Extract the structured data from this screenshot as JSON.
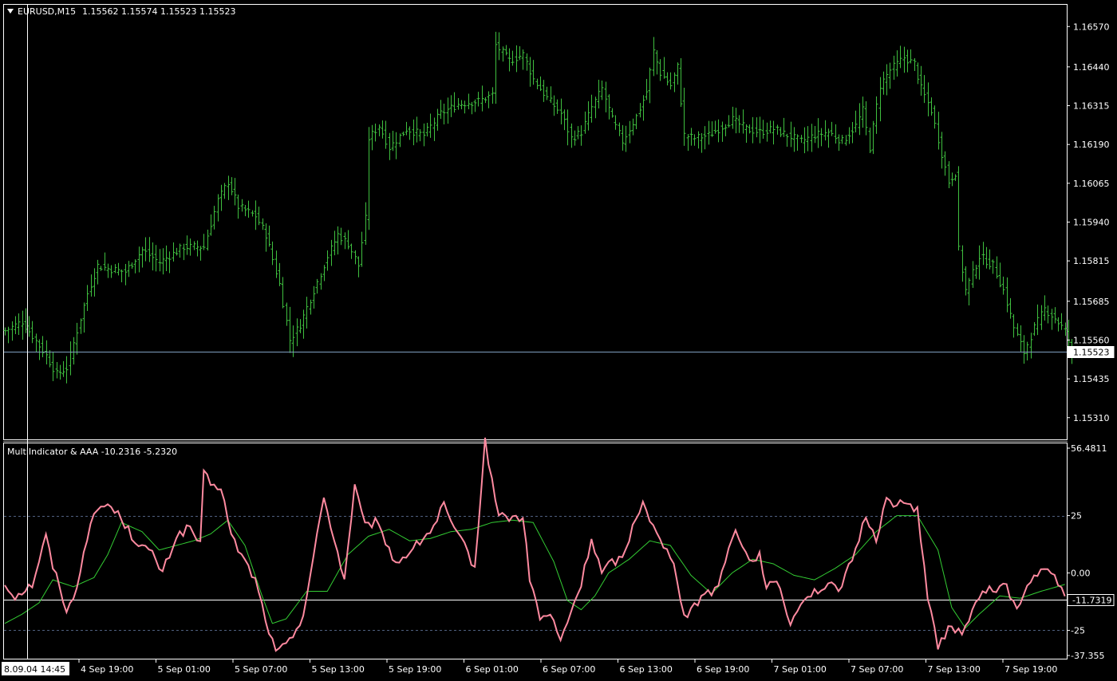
{
  "main_panel": {
    "symbol_timeframe": "EURUSD,M15",
    "ohlc": "1.15562 1.15574 1.15523 1.15523",
    "menu_icon": "triangle-down-icon",
    "current_price_label": "1.15523",
    "price_ticks": [
      "1.16570",
      "1.16440",
      "1.16315",
      "1.16190",
      "1.16065",
      "1.15940",
      "1.15815",
      "1.15685",
      "1.15560",
      "1.15435",
      "1.15310"
    ]
  },
  "indicator_panel": {
    "title": "MultiIndicator & AAA -10.2316 -5.2320",
    "ticks": [
      "56.4811",
      "25",
      "0.00",
      "-11.7319",
      "-25",
      "-37.355"
    ]
  },
  "time_axis": {
    "cursor_label": "8.09.04 14:45",
    "labels": [
      "4 Sep 19:00",
      "5 Sep 01:00",
      "5 Sep 07:00",
      "5 Sep 13:00",
      "5 Sep 19:00",
      "6 Sep 01:00",
      "6 Sep 07:00",
      "6 Sep 13:00",
      "6 Sep 19:00",
      "7 Sep 01:00",
      "7 Sep 07:00",
      "7 Sep 13:00",
      "7 Sep 19:00"
    ]
  },
  "colors": {
    "background": "#000000",
    "bars": "#3fbf3f",
    "fast_line": "#ff8aa0",
    "slow_line": "#33cc33",
    "grid_level": "#506080",
    "text": "#ffffff"
  },
  "chart_data": [
    {
      "type": "ohlc",
      "title": "EURUSD,M15",
      "ylim": [
        1.1524,
        1.1664
      ],
      "current_price": 1.15523,
      "close_anchors": [
        [
          0,
          1.1559
        ],
        [
          5,
          1.1562
        ],
        [
          12,
          1.1551
        ],
        [
          15,
          1.1545
        ],
        [
          18,
          1.1547
        ],
        [
          20,
          1.1555
        ],
        [
          24,
          1.1571
        ],
        [
          27,
          1.158
        ],
        [
          30,
          1.1579
        ],
        [
          35,
          1.1578
        ],
        [
          40,
          1.1585
        ],
        [
          45,
          1.1581
        ],
        [
          52,
          1.1586
        ],
        [
          58,
          1.1586
        ],
        [
          62,
          1.1601
        ],
        [
          65,
          1.1607
        ],
        [
          68,
          1.1599
        ],
        [
          73,
          1.1596
        ],
        [
          76,
          1.159
        ],
        [
          80,
          1.1574
        ],
        [
          83,
          1.1556
        ],
        [
          86,
          1.1561
        ],
        [
          90,
          1.1572
        ],
        [
          94,
          1.1583
        ],
        [
          97,
          1.159
        ],
        [
          100,
          1.1587
        ],
        [
          103,
          1.158
        ],
        [
          105,
          1.1595
        ],
        [
          106,
          1.1621
        ],
        [
          109,
          1.1625
        ],
        [
          112,
          1.1618
        ],
        [
          117,
          1.1624
        ],
        [
          122,
          1.1622
        ],
        [
          127,
          1.1629
        ],
        [
          132,
          1.1632
        ],
        [
          138,
          1.1633
        ],
        [
          142,
          1.1635
        ],
        [
          143,
          1.1651
        ],
        [
          147,
          1.1646
        ],
        [
          151,
          1.1648
        ],
        [
          154,
          1.164
        ],
        [
          158,
          1.1634
        ],
        [
          162,
          1.1629
        ],
        [
          165,
          1.1621
        ],
        [
          168,
          1.1623
        ],
        [
          171,
          1.1631
        ],
        [
          174,
          1.1637
        ],
        [
          177,
          1.1627
        ],
        [
          180,
          1.162
        ],
        [
          184,
          1.1628
        ],
        [
          187,
          1.1636
        ],
        [
          189,
          1.1649
        ],
        [
          191,
          1.1642
        ],
        [
          194,
          1.1638
        ],
        [
          196,
          1.1644
        ],
        [
          198,
          1.1622
        ],
        [
          201,
          1.1621
        ],
        [
          205,
          1.1622
        ],
        [
          208,
          1.1624
        ],
        [
          212,
          1.1627
        ],
        [
          216,
          1.1624
        ],
        [
          220,
          1.1623
        ],
        [
          224,
          1.1624
        ],
        [
          228,
          1.1622
        ],
        [
          232,
          1.162
        ],
        [
          236,
          1.1622
        ],
        [
          240,
          1.1623
        ],
        [
          244,
          1.162
        ],
        [
          248,
          1.1625
        ],
        [
          250,
          1.163
        ],
        [
          252,
          1.1618
        ],
        [
          255,
          1.1638
        ],
        [
          258,
          1.1643
        ],
        [
          262,
          1.1647
        ],
        [
          265,
          1.1645
        ],
        [
          267,
          1.1637
        ],
        [
          270,
          1.163
        ],
        [
          273,
          1.1616
        ],
        [
          275,
          1.1607
        ],
        [
          277,
          1.161
        ],
        [
          278,
          1.1585
        ],
        [
          280,
          1.1572
        ],
        [
          284,
          1.1583
        ],
        [
          288,
          1.158
        ],
        [
          291,
          1.1572
        ],
        [
          294,
          1.156
        ],
        [
          297,
          1.1552
        ],
        [
          300,
          1.156
        ],
        [
          303,
          1.1566
        ],
        [
          306,
          1.1563
        ],
        [
          309,
          1.1559
        ],
        [
          311,
          1.1552
        ]
      ]
    },
    {
      "type": "line",
      "title": "MultiIndicator & AAA -10.2316 -5.2320",
      "ylim": [
        -37.355,
        56.4811
      ],
      "levels": [
        25,
        -25
      ],
      "current_value": -11.7319,
      "series": [
        {
          "color": "#ff8aa0",
          "anchors": [
            [
              0,
              -5
            ],
            [
              3,
              -10
            ],
            [
              8,
              -5
            ],
            [
              12,
              16
            ],
            [
              14,
              3
            ],
            [
              16,
              -6
            ],
            [
              18,
              -16
            ],
            [
              20,
              -12
            ],
            [
              24,
              16
            ],
            [
              27,
              28
            ],
            [
              30,
              30
            ],
            [
              34,
              24
            ],
            [
              37,
              16
            ],
            [
              40,
              12
            ],
            [
              43,
              8
            ],
            [
              46,
              0
            ],
            [
              50,
              16
            ],
            [
              54,
              20
            ],
            [
              57,
              12
            ],
            [
              58,
              43
            ],
            [
              61,
              37
            ],
            [
              63,
              38
            ],
            [
              66,
              16
            ],
            [
              70,
              5
            ],
            [
              73,
              -3
            ],
            [
              76,
              -20
            ],
            [
              79,
              -35
            ],
            [
              83,
              -30
            ],
            [
              87,
              -18
            ],
            [
              90,
              7
            ],
            [
              93,
              33
            ],
            [
              96,
              15
            ],
            [
              99,
              -3
            ],
            [
              102,
              38
            ],
            [
              105,
              20
            ],
            [
              108,
              22
            ],
            [
              111,
              14
            ],
            [
              114,
              4
            ],
            [
              117,
              8
            ],
            [
              120,
              12
            ],
            [
              125,
              20
            ],
            [
              128,
              30
            ],
            [
              131,
              18
            ],
            [
              134,
              12
            ],
            [
              137,
              2
            ],
            [
              140,
              57
            ],
            [
              144,
              25
            ],
            [
              148,
              24
            ],
            [
              151,
              24
            ],
            [
              153,
              -2
            ],
            [
              156,
              -20
            ],
            [
              159,
              -18
            ],
            [
              162,
              -30
            ],
            [
              165,
              -17
            ],
            [
              168,
              -5
            ],
            [
              171,
              15
            ],
            [
              174,
              0
            ],
            [
              177,
              5
            ],
            [
              180,
              6
            ],
            [
              183,
              20
            ],
            [
              186,
              32
            ],
            [
              189,
              20
            ],
            [
              192,
              11
            ],
            [
              195,
              6
            ],
            [
              198,
              -19
            ],
            [
              201,
              -15
            ],
            [
              204,
              -8
            ],
            [
              207,
              -8
            ],
            [
              210,
              5
            ],
            [
              213,
              20
            ],
            [
              217,
              5
            ],
            [
              220,
              8
            ],
            [
              222,
              -5
            ],
            [
              226,
              -6
            ],
            [
              229,
              -23
            ],
            [
              232,
              -12
            ],
            [
              236,
              -8
            ],
            [
              240,
              -6
            ],
            [
              244,
              -6
            ],
            [
              248,
              10
            ],
            [
              251,
              25
            ],
            [
              254,
              15
            ],
            [
              257,
              32
            ],
            [
              260,
              30
            ],
            [
              263,
              30
            ],
            [
              266,
              28
            ],
            [
              269,
              -10
            ],
            [
              272,
              -33
            ],
            [
              276,
              -22
            ],
            [
              279,
              -28
            ],
            [
              282,
              -15
            ],
            [
              286,
              -8
            ],
            [
              289,
              -7
            ],
            [
              292,
              -5
            ],
            [
              295,
              -17
            ],
            [
              298,
              -6
            ],
            [
              302,
              2
            ],
            [
              306,
              -2
            ],
            [
              309,
              -10
            ]
          ]
        },
        {
          "color": "#33cc33",
          "anchors": [
            [
              0,
              -22
            ],
            [
              5,
              -18
            ],
            [
              10,
              -13
            ],
            [
              14,
              -3
            ],
            [
              20,
              -6
            ],
            [
              26,
              -2
            ],
            [
              30,
              8
            ],
            [
              34,
              22
            ],
            [
              40,
              18
            ],
            [
              45,
              10
            ],
            [
              50,
              12
            ],
            [
              55,
              14
            ],
            [
              60,
              17
            ],
            [
              65,
              23
            ],
            [
              70,
              12
            ],
            [
              75,
              -10
            ],
            [
              78,
              -22
            ],
            [
              82,
              -20
            ],
            [
              88,
              -8
            ],
            [
              94,
              -8
            ],
            [
              100,
              8
            ],
            [
              106,
              16
            ],
            [
              112,
              19
            ],
            [
              118,
              14
            ],
            [
              124,
              15
            ],
            [
              130,
              18
            ],
            [
              136,
              19
            ],
            [
              142,
              22
            ],
            [
              148,
              23
            ],
            [
              154,
              22
            ],
            [
              160,
              5
            ],
            [
              164,
              -12
            ],
            [
              168,
              -16
            ],
            [
              172,
              -10
            ],
            [
              176,
              0
            ],
            [
              182,
              6
            ],
            [
              188,
              14
            ],
            [
              194,
              12
            ],
            [
              200,
              -1
            ],
            [
              206,
              -9
            ],
            [
              212,
              0
            ],
            [
              218,
              6
            ],
            [
              224,
              4
            ],
            [
              230,
              -1
            ],
            [
              236,
              -3
            ],
            [
              242,
              2
            ],
            [
              248,
              8
            ],
            [
              254,
              18
            ],
            [
              260,
              25
            ],
            [
              266,
              25
            ],
            [
              272,
              10
            ],
            [
              276,
              -15
            ],
            [
              280,
              -24
            ],
            [
              284,
              -18
            ],
            [
              290,
              -10
            ],
            [
              296,
              -11
            ],
            [
              302,
              -8
            ],
            [
              309,
              -5
            ]
          ]
        }
      ]
    }
  ]
}
